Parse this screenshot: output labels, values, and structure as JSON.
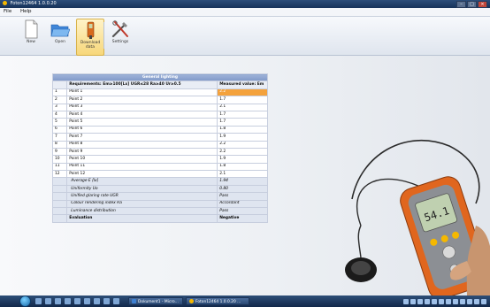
{
  "window": {
    "title": "Foton12464 1.0.0.20"
  },
  "menu": [
    "File",
    "Help"
  ],
  "toolbar": {
    "new": "New",
    "open": "Open",
    "download_line1": "Download",
    "download_line2": "data",
    "settings": "Settings"
  },
  "table": {
    "caption": "General lighting",
    "header_requirements": "Requirements: Em≥100[Lx]  UGR≤28  Ra≥40  Ur≥0.5",
    "header_measured": "Measured value: Em",
    "rows": [
      {
        "n": "1",
        "point": "Point 1",
        "value": "2.2"
      },
      {
        "n": "2",
        "point": "Point 2",
        "value": "1.7"
      },
      {
        "n": "3",
        "point": "Point 3",
        "value": "2.1"
      },
      {
        "n": "4",
        "point": "Point 4",
        "value": "1.7"
      },
      {
        "n": "5",
        "point": "Point 5",
        "value": "1.7"
      },
      {
        "n": "6",
        "point": "Point 6",
        "value": "1.8"
      },
      {
        "n": "7",
        "point": "Point 7",
        "value": "1.9"
      },
      {
        "n": "8",
        "point": "Point 8",
        "value": "2.2"
      },
      {
        "n": "9",
        "point": "Point 9",
        "value": "2.2"
      },
      {
        "n": "10",
        "point": "Point 10",
        "value": "1.9"
      },
      {
        "n": "11",
        "point": "Point 11",
        "value": "1.8"
      },
      {
        "n": "12",
        "point": "Point 12",
        "value": "2.1"
      }
    ],
    "summary": [
      {
        "label": "Average E [lx]",
        "value": "1.94"
      },
      {
        "label": "Uniformity Uo",
        "value": "0.80"
      },
      {
        "label": "Unified glaring rate UGR",
        "value": "Pass"
      },
      {
        "label": "Colour rendering index Ra",
        "value": "Accordant"
      },
      {
        "label": "Luminance distribution",
        "value": "Pass"
      }
    ],
    "evaluation_label": "Evaluation",
    "evaluation_value": "Negative"
  },
  "device": {
    "display": "54.1"
  },
  "taskbar": {
    "task1": "Dokument1 - Micro...",
    "task2": "Foton12464 1.0.0.20 ..."
  },
  "colors": {
    "highlight": "#f4a23c",
    "header_blue": "#8fa7d3"
  }
}
